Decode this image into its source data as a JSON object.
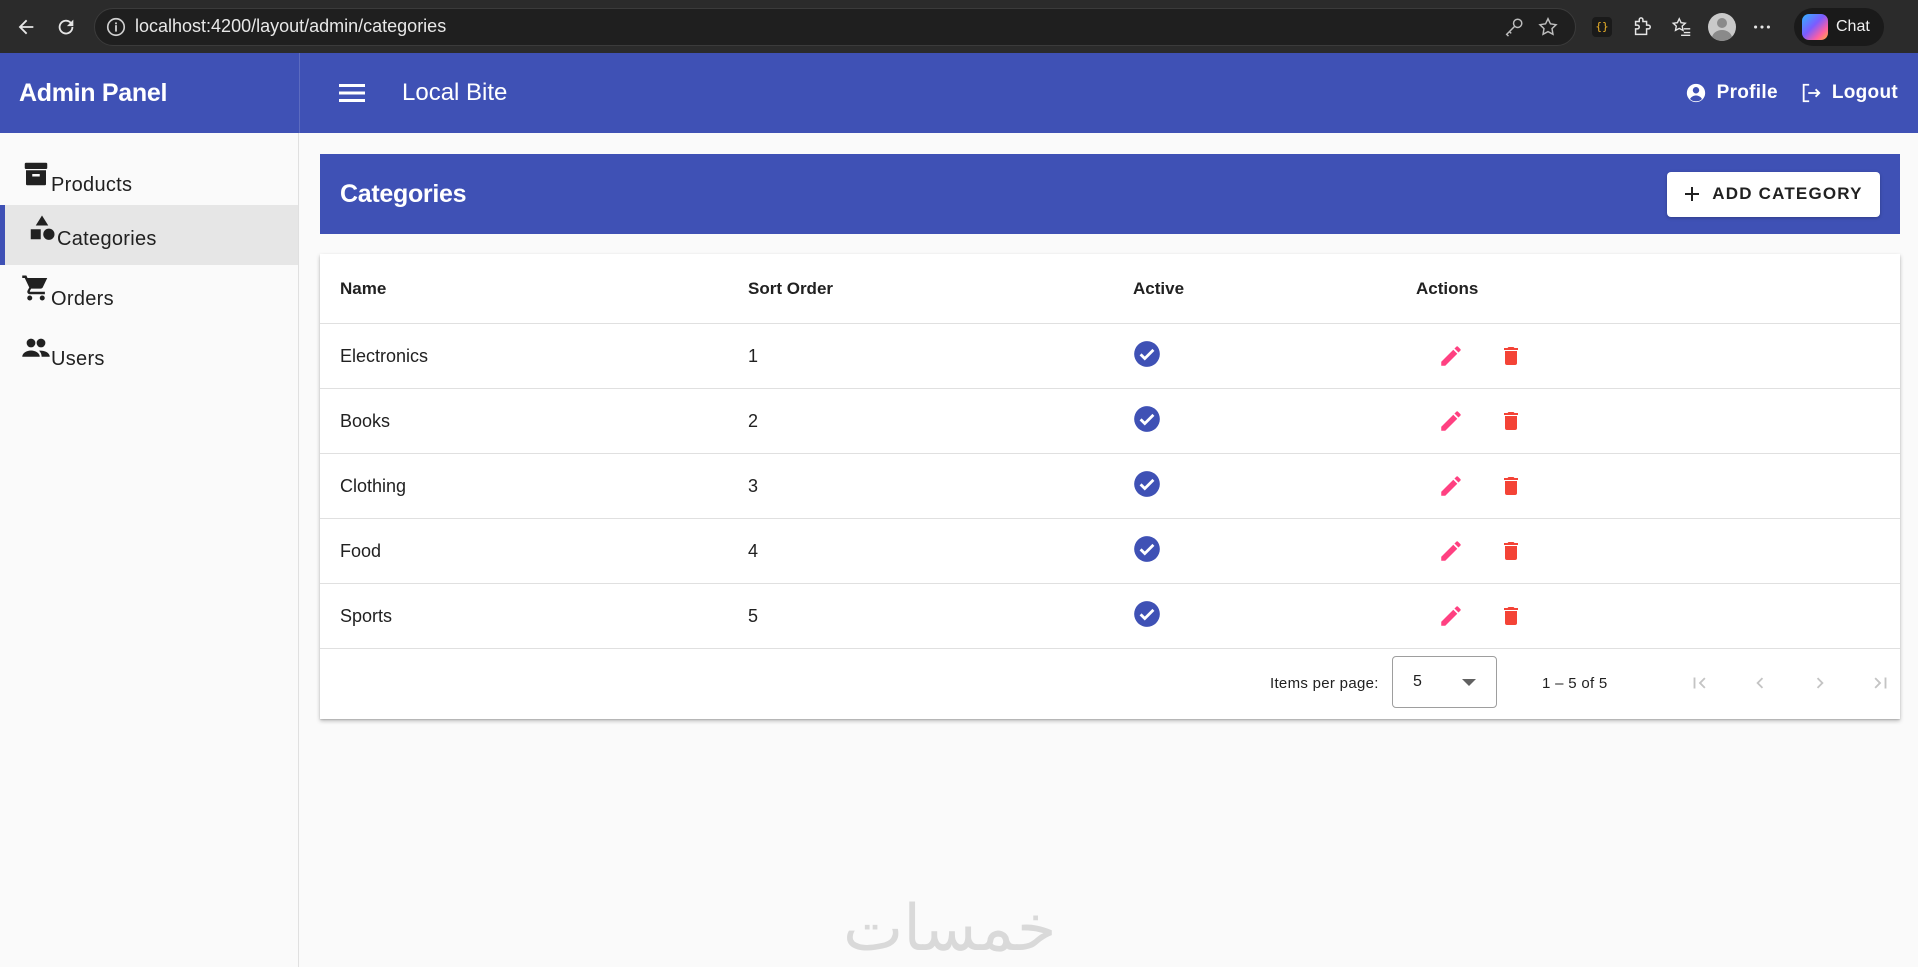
{
  "browser": {
    "url": "localhost:4200/layout/admin/categories",
    "chat_label": "Chat",
    "ext_label": "{}"
  },
  "sidebar": {
    "title": "Admin Panel",
    "items": [
      {
        "label": "Products",
        "icon": "archive-box-icon"
      },
      {
        "label": "Categories",
        "icon": "category-shapes-icon",
        "active": true
      },
      {
        "label": "Orders",
        "icon": "shopping-cart-icon"
      },
      {
        "label": "Users",
        "icon": "people-icon"
      }
    ]
  },
  "topbar": {
    "app_title": "Local Bite",
    "profile_label": "Profile",
    "logout_label": "Logout"
  },
  "page": {
    "title": "Categories",
    "add_button_label": "ADD CATEGORY"
  },
  "table": {
    "columns": [
      "Name",
      "Sort Order",
      "Active",
      "Actions"
    ],
    "rows": [
      {
        "name": "Electronics",
        "sort_order": "1",
        "active": true
      },
      {
        "name": "Books",
        "sort_order": "2",
        "active": true
      },
      {
        "name": "Clothing",
        "sort_order": "3",
        "active": true
      },
      {
        "name": "Food",
        "sort_order": "4",
        "active": true
      },
      {
        "name": "Sports",
        "sort_order": "5",
        "active": true
      }
    ]
  },
  "paginator": {
    "items_per_page_label": "Items per page:",
    "items_per_page_value": "5",
    "range_label": "1 – 5 of 5"
  },
  "watermark": "خمسات",
  "colors": {
    "primary": "#3f51b5",
    "edit": "#ff4081",
    "delete": "#f44336"
  }
}
